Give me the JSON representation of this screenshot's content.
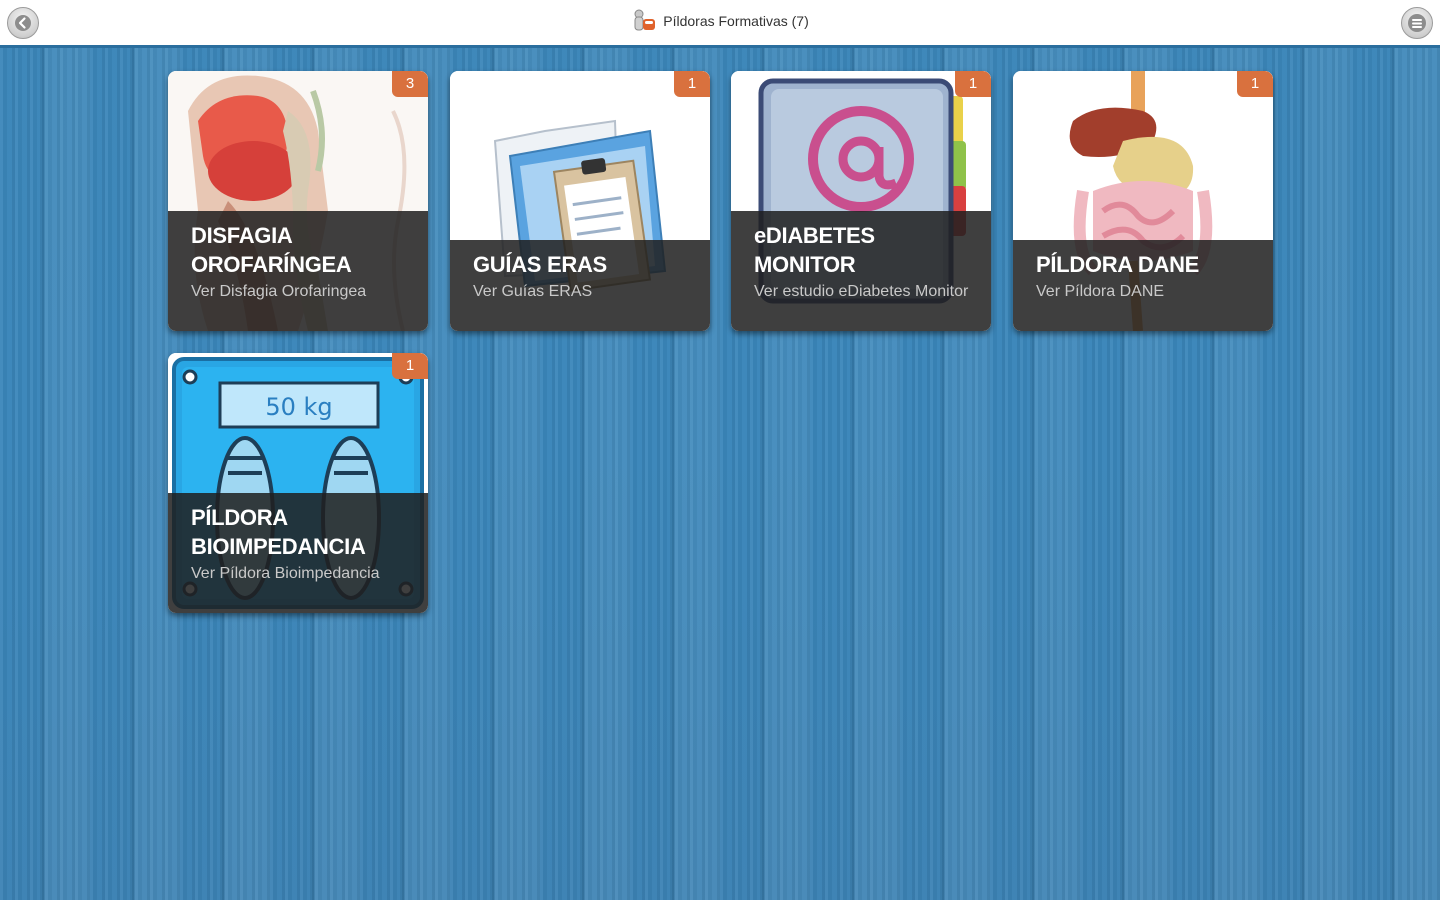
{
  "header": {
    "title": "Píldoras Formativas (7)",
    "back_icon": "back-arrow-icon",
    "menu_icon": "menu-lines-icon"
  },
  "colors": {
    "background": "#3a86ba",
    "badge": "#d9713e",
    "caption_bg": "#202020"
  },
  "cards": [
    {
      "title": "DISFAGIA OROFARÍNGEA",
      "subtitle": "Ver Disfagia Orofaringea",
      "badge": "3",
      "thumb": "anatomy-throat"
    },
    {
      "title": "GUÍAS ERAS",
      "subtitle": "Ver Guías ERAS",
      "badge": "1",
      "thumb": "folder-clipboard"
    },
    {
      "title": "eDIABETES MONITOR",
      "subtitle": "Ver estudio eDiabetes Monitor",
      "badge": "1",
      "thumb": "address-book-at"
    },
    {
      "title": "PÍLDORA DANE",
      "subtitle": "Ver Píldora DANE",
      "badge": "1",
      "thumb": "digestive-system"
    },
    {
      "title": "PÍLDORA BIOIMPEDANCIA",
      "subtitle": "Ver Píldora Bioimpedancia",
      "badge": "1",
      "thumb": "weight-scale",
      "scale_reading": "50 kg"
    }
  ]
}
